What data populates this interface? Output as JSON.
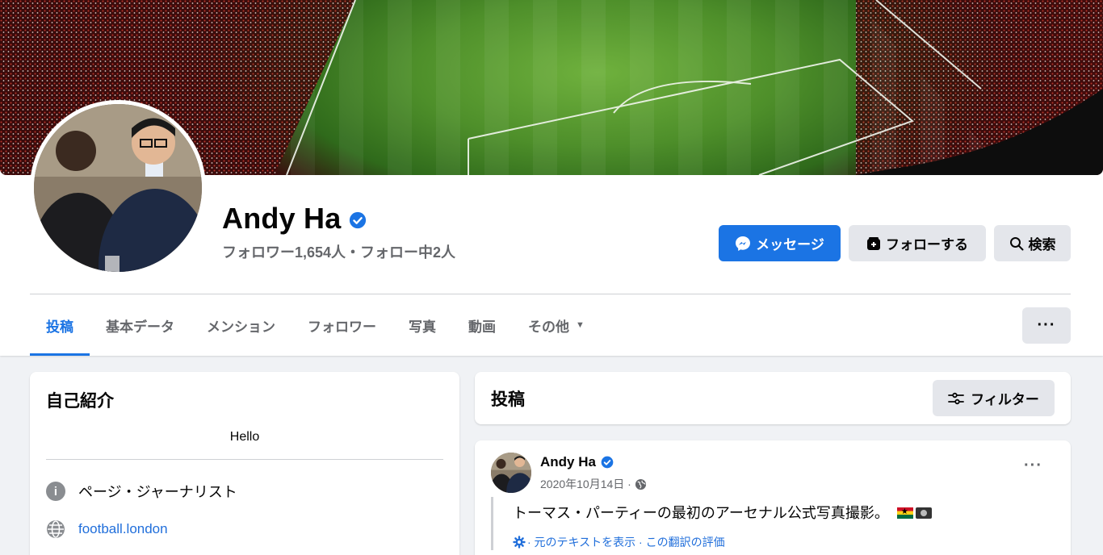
{
  "profile": {
    "name": "Andy Ha",
    "verified": true,
    "stats": "フォロワー1,654人・フォロー中2人"
  },
  "actions": {
    "message_label": "メッセージ",
    "follow_label": "フォローする",
    "search_label": "検索",
    "more_label": "···"
  },
  "tabs": [
    {
      "label": "投稿",
      "active": true
    },
    {
      "label": "基本データ"
    },
    {
      "label": "メンション"
    },
    {
      "label": "フォロワー"
    },
    {
      "label": "写真"
    },
    {
      "label": "動画"
    },
    {
      "label": "その他"
    }
  ],
  "intro": {
    "title": "自己紹介",
    "bio": "Hello",
    "category": "ページ・ジャーナリスト",
    "website": "football.london"
  },
  "posts_section": {
    "title": "投稿",
    "filter_label": "フィルター"
  },
  "post": {
    "author": "Andy Ha",
    "date": "2020年10月14日 ·",
    "text": "トーマス・パーティーの最初のアーセナル公式写真撮影。",
    "translation_note": "· 元のテキストを表示 · この翻訳の評価",
    "menu_label": "···"
  },
  "colors": {
    "accent": "#1b74e4",
    "link": "#216fdb",
    "button_gray": "#e4e6eb",
    "secondary_text": "#65676b"
  }
}
